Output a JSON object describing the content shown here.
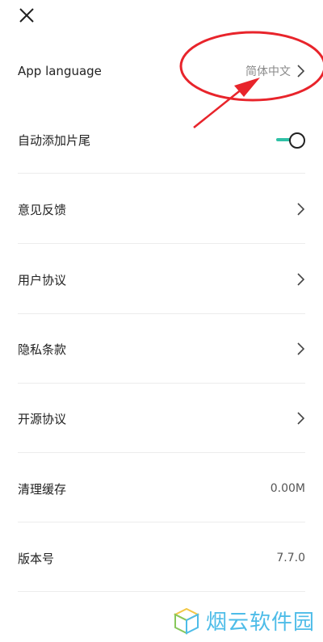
{
  "header": {
    "close_icon": "close-icon"
  },
  "settings": {
    "language": {
      "label": "App language",
      "value": "简体中文"
    },
    "auto_trailer": {
      "label": "自动添加片尾",
      "toggle_on": true
    },
    "feedback": {
      "label": "意见反馈"
    },
    "user_agreement": {
      "label": "用户协议"
    },
    "privacy_terms": {
      "label": "隐私条款"
    },
    "open_source": {
      "label": "开源协议"
    },
    "clear_cache": {
      "label": "清理缓存",
      "value": "0.00M"
    },
    "version": {
      "label": "版本号",
      "value": "7.7.0"
    }
  },
  "watermark": {
    "text": "烟云软件园"
  },
  "colors": {
    "accent": "#2fc1a6",
    "annotation": "#e8242b",
    "watermark": "#3ab5e6"
  }
}
